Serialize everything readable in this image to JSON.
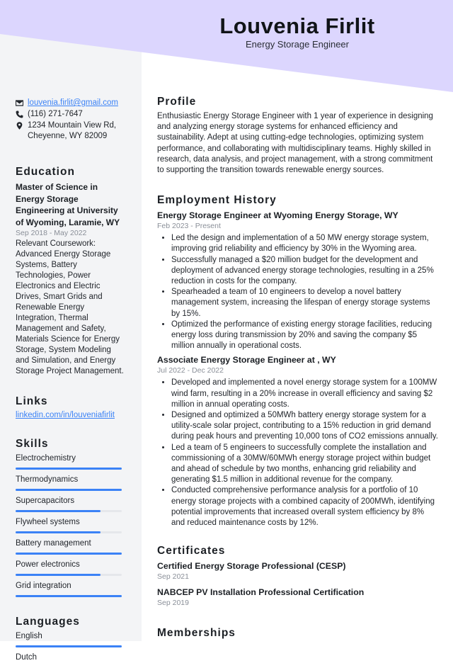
{
  "colors": {
    "header_bg": "#dcd6fe",
    "sidebar_bg": "#f3f4f6",
    "accent": "#3b82f6",
    "track": "#e5e7eb"
  },
  "header": {
    "name": "Louvenia Firlit",
    "role": "Energy Storage Engineer"
  },
  "contact": {
    "email": "louvenia.firlit@gmail.com",
    "phone": "(116) 271-7647",
    "address_line1": "1234 Mountain View Rd,",
    "address_line2": "Cheyenne, WY 82009",
    "icons": [
      "envelope-icon",
      "phone-icon",
      "map-pin-icon"
    ]
  },
  "education": {
    "title": "Education",
    "degree": "Master of Science in Energy Storage Engineering at University of Wyoming, Laramie, WY",
    "dates": "Sep 2018 - May 2022",
    "description": "Relevant Coursework: Advanced Energy Storage Systems, Battery Technologies, Power Electronics and Electric Drives, Smart Grids and Renewable Energy Integration, Thermal Management and Safety, Materials Science for Energy Storage, System Modeling and Simulation, and Energy Storage Project Management."
  },
  "links": {
    "title": "Links",
    "items": [
      {
        "label": "linkedin.com/in/louveniafirlit"
      }
    ]
  },
  "skills": {
    "title": "Skills",
    "items": [
      {
        "label": "Electrochemistry",
        "level": 1.0
      },
      {
        "label": "Thermodynamics",
        "level": 1.0
      },
      {
        "label": "Supercapacitors",
        "level": 0.8
      },
      {
        "label": "Flywheel systems",
        "level": 0.8
      },
      {
        "label": "Battery management",
        "level": 1.0
      },
      {
        "label": "Power electronics",
        "level": 0.8
      },
      {
        "label": "Grid integration",
        "level": 1.0
      }
    ]
  },
  "languages": {
    "title": "Languages",
    "items": [
      {
        "label": "English",
        "level": 1.0
      },
      {
        "label": "Dutch",
        "level": null
      }
    ]
  },
  "profile": {
    "title": "Profile",
    "text": "Enthusiastic Energy Storage Engineer with 1 year of experience in designing and analyzing energy storage systems for enhanced efficiency and sustainability. Adept at using cutting-edge technologies, optimizing system performance, and collaborating with multidisciplinary teams. Highly skilled in research, data analysis, and project management, with a strong commitment to supporting the transition towards renewable energy sources."
  },
  "employment": {
    "title": "Employment History",
    "jobs": [
      {
        "title": "Energy Storage Engineer at Wyoming Energy Storage, WY",
        "dates": "Feb 2023 - Present",
        "bullets": [
          "Led the design and implementation of a 50 MW energy storage system, improving grid reliability and efficiency by 30% in the Wyoming area.",
          "Successfully managed a $20 million budget for the development and deployment of advanced energy storage technologies, resulting in a 25% reduction in costs for the company.",
          "Spearheaded a team of 10 engineers to develop a novel battery management system, increasing the lifespan of energy storage systems by 15%.",
          "Optimized the performance of existing energy storage facilities, reducing energy loss during transmission by 20% and saving the company $5 million annually in operational costs."
        ]
      },
      {
        "title": "Associate Energy Storage Engineer at , WY",
        "dates": "Jul 2022 - Dec 2022",
        "bullets": [
          "Developed and implemented a novel energy storage system for a 100MW wind farm, resulting in a 20% increase in overall efficiency and saving $2 million in annual operating costs.",
          "Designed and optimized a 50MWh battery energy storage system for a utility-scale solar project, contributing to a 15% reduction in grid demand during peak hours and preventing 10,000 tons of CO2 emissions annually.",
          "Led a team of 5 engineers to successfully complete the installation and commissioning of a 30MW/60MWh energy storage project within budget and ahead of schedule by two months, enhancing grid reliability and generating $1.5 million in additional revenue for the company.",
          "Conducted comprehensive performance analysis for a portfolio of 10 energy storage projects with a combined capacity of 200MWh, identifying potential improvements that increased overall system efficiency by 8% and reduced maintenance costs by 12%."
        ]
      }
    ]
  },
  "certificates": {
    "title": "Certificates",
    "items": [
      {
        "title": "Certified Energy Storage Professional (CESP)",
        "date": "Sep 2021"
      },
      {
        "title": "NABCEP PV Installation Professional Certification",
        "date": "Sep 2019"
      }
    ]
  },
  "memberships": {
    "title": "Memberships"
  }
}
